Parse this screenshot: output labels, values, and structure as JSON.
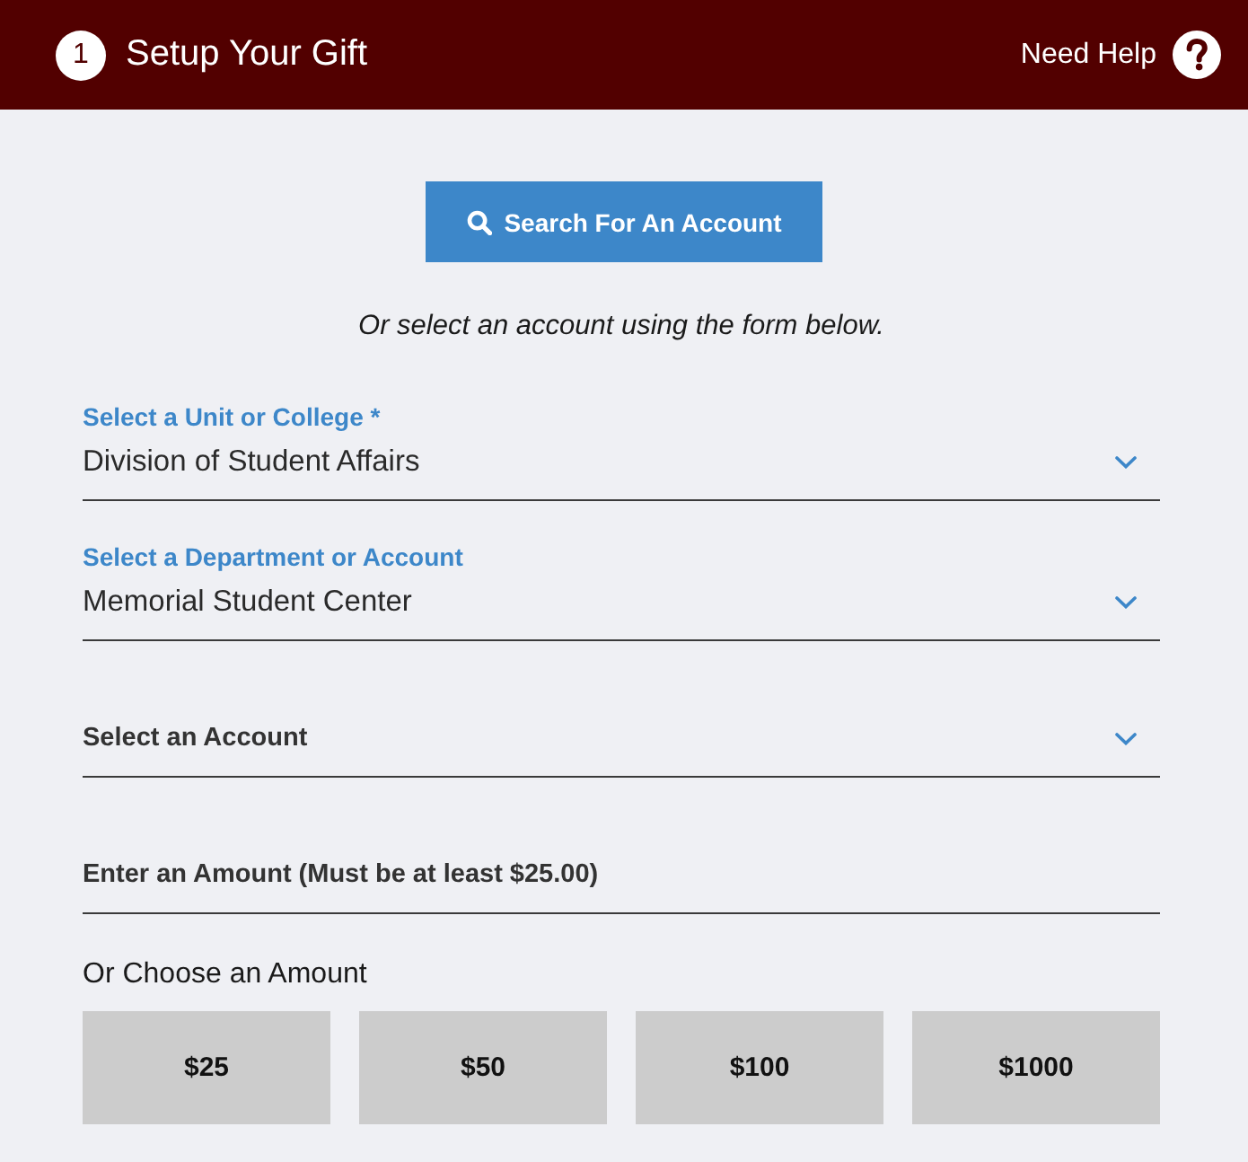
{
  "header": {
    "step": "1",
    "title": "Setup Your Gift",
    "help_label": "Need Help"
  },
  "search_button": {
    "label": "Search For An Account"
  },
  "instructions": "Or select an account using the form below.",
  "fields": [
    {
      "kind": "select",
      "label": "Select a Unit or College *",
      "value": "Division of Student Affairs"
    },
    {
      "kind": "select",
      "label": "Select a Department or Account",
      "value": "Memorial Student Center"
    },
    {
      "kind": "select",
      "label": "Select an Account"
    },
    {
      "kind": "input",
      "label": "Enter an Amount (Must be at least $25.00)"
    }
  ],
  "amount_choices": {
    "label": "Or Choose an Amount",
    "options": [
      {
        "label": "$25",
        "selected": false
      },
      {
        "label": "$50",
        "selected": false
      },
      {
        "label": "$100",
        "selected": false
      },
      {
        "label": "$1000",
        "selected": false
      }
    ]
  }
}
